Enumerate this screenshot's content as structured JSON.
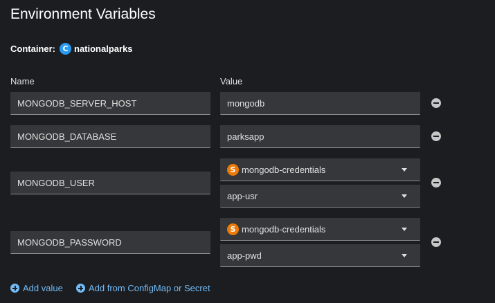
{
  "title": "Environment Variables",
  "container": {
    "label": "Container:",
    "badge": "C",
    "name": "nationalparks"
  },
  "columns": {
    "name": "Name",
    "value": "Value"
  },
  "rows": [
    {
      "name": "MONGODB_SERVER_HOST",
      "value": "mongodb"
    },
    {
      "name": "MONGODB_DATABASE",
      "value": "parksapp"
    },
    {
      "name": "MONGODB_USER",
      "resource_badge": "S",
      "resource": "mongodb-credentials",
      "key": "app-usr"
    },
    {
      "name": "MONGODB_PASSWORD",
      "resource_badge": "S",
      "resource": "mongodb-credentials",
      "key": "app-pwd"
    }
  ],
  "actions": {
    "add_value": "Add value",
    "add_from": "Add from ConfigMap or Secret"
  },
  "colors": {
    "background": "#1b1d21",
    "field": "#36373a",
    "link": "#73bcf7",
    "container_badge": "#2b9af3",
    "secret_badge": "#ec7a08"
  }
}
